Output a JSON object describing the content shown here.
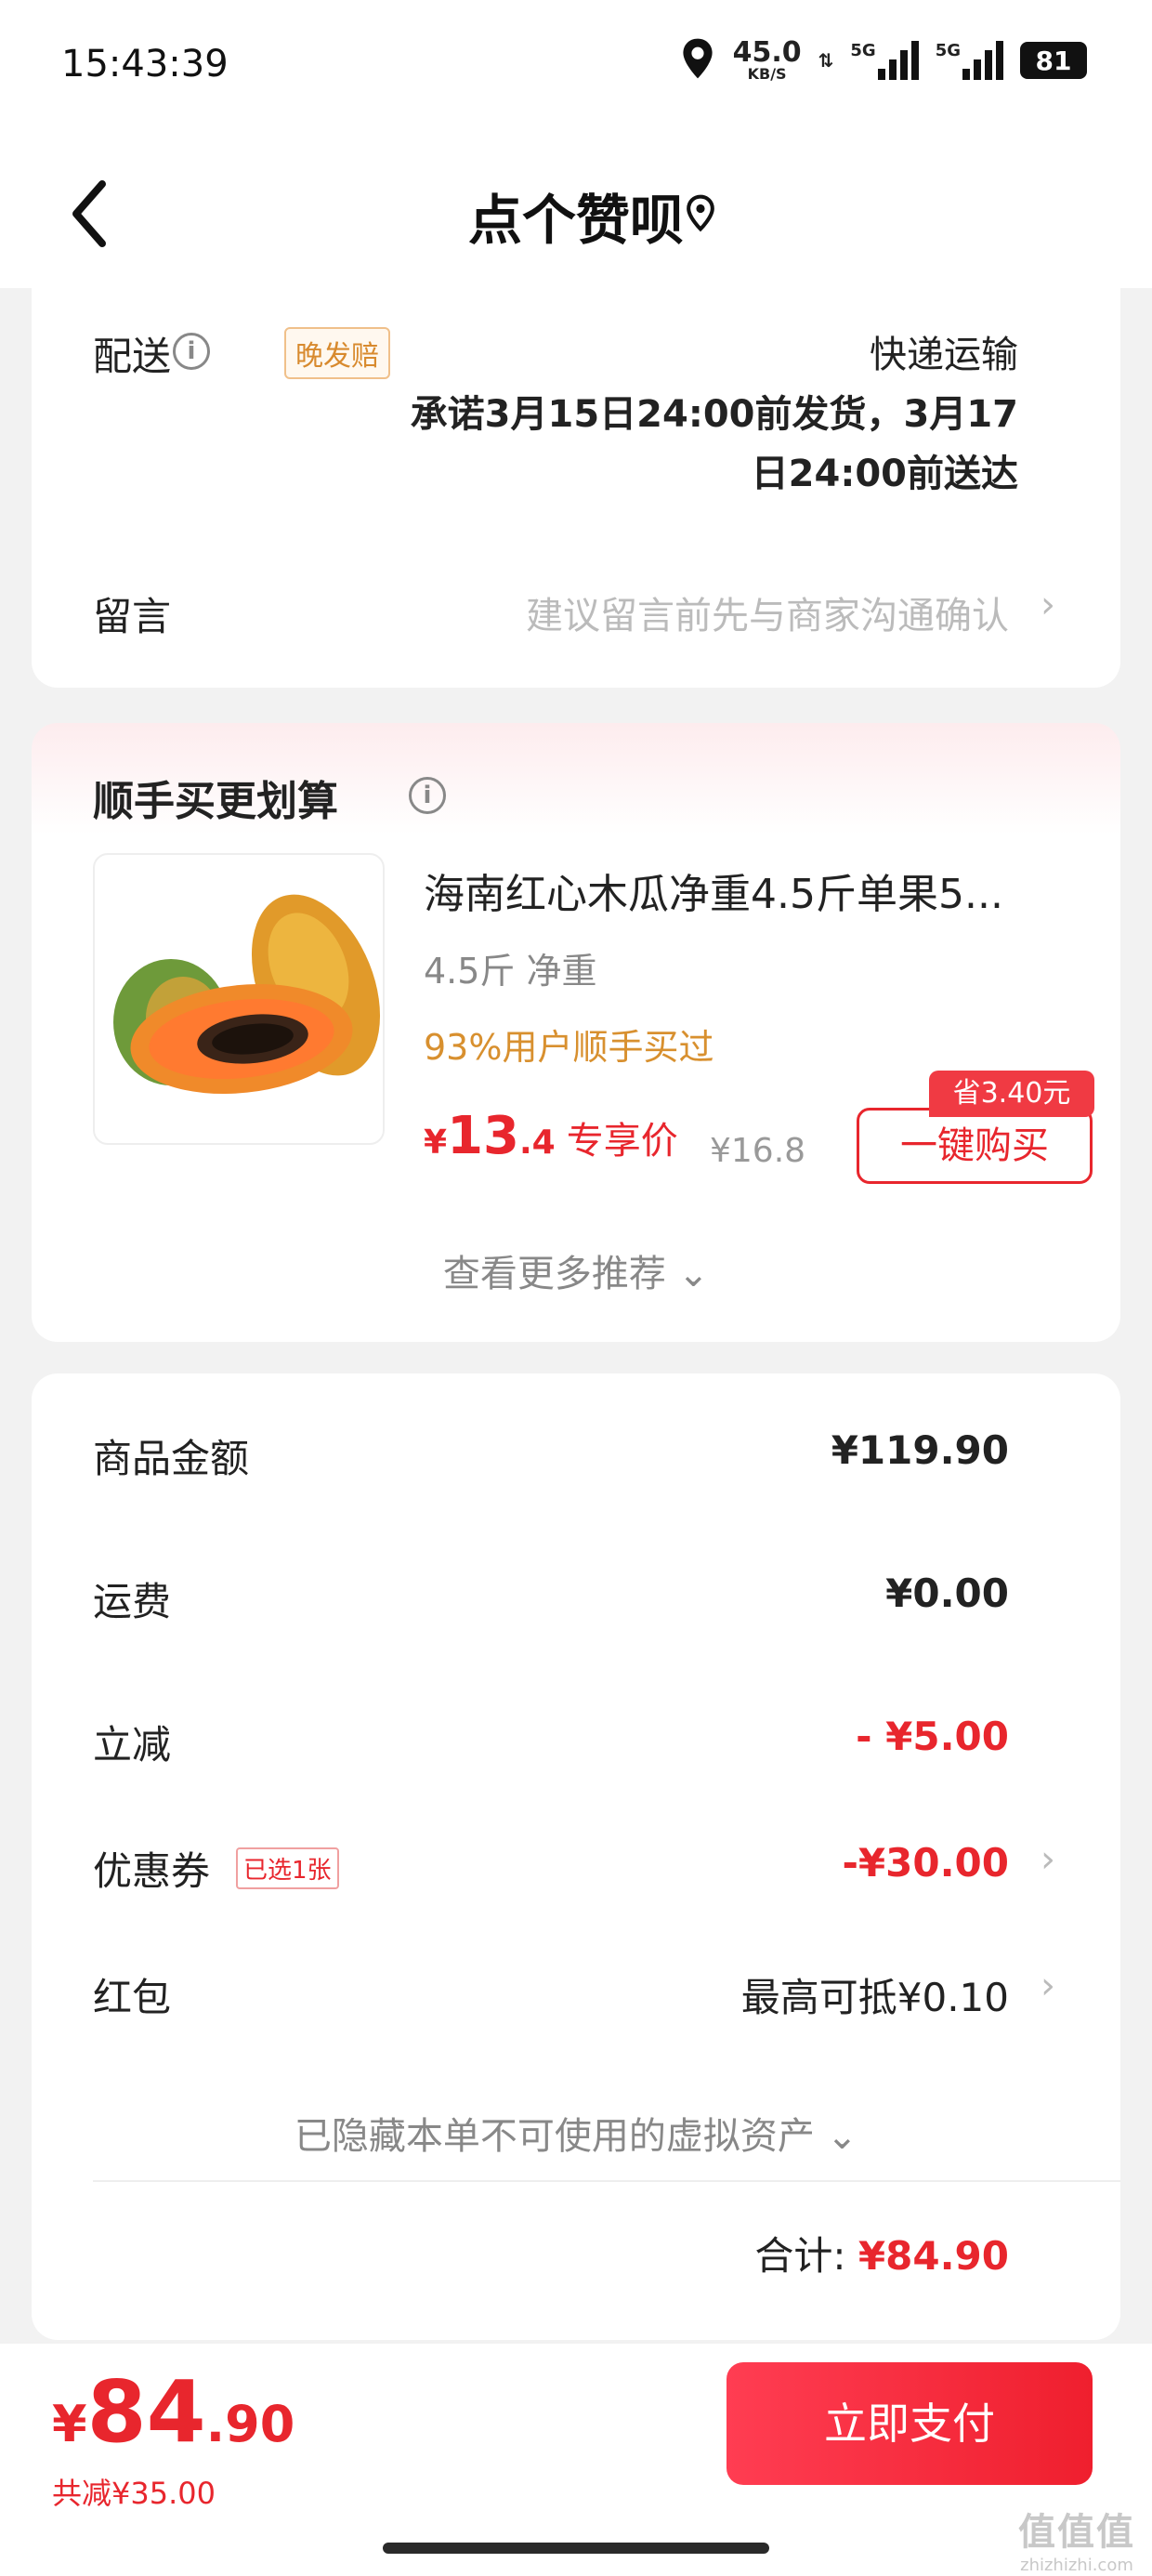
{
  "status_bar": {
    "time": "15:43:39",
    "speed_value": "45.0",
    "speed_unit": "KB/S",
    "net1_label": "5G",
    "net2_label": "5G",
    "battery": "81"
  },
  "header": {
    "title": "点个赞呗"
  },
  "delivery": {
    "label": "配送",
    "badge": "晚发赔",
    "method": "快递运输",
    "promise_line1": "承诺3月15日24:00前发货，3月17",
    "promise_line2": "日24:00前送达",
    "message_label": "留言",
    "message_placeholder": "建议留言前先与商家沟通确认"
  },
  "recommend": {
    "title": "顺手买更划算",
    "product_name": "海南红心木瓜净重4.5斤单果5...",
    "spec": "4.5斤 净重",
    "stat": "93%用户顺手买过",
    "price_currency": "¥",
    "price_int": "13",
    "price_dec": ".4",
    "price_tag": "专享价",
    "original_price": "¥16.8",
    "save_badge": "省3.40元",
    "buy_button": "一键购买",
    "more": "查看更多推荐"
  },
  "summary": {
    "rows": [
      {
        "label": "商品金额",
        "value": "¥119.90"
      },
      {
        "label": "运费",
        "value": "¥0.00"
      },
      {
        "label": "立减",
        "value": "- ¥5.00"
      },
      {
        "label": "优惠券",
        "value": "-¥30.00",
        "badge": "已选1张"
      },
      {
        "label": "红包",
        "value": "最高可抵¥0.10"
      }
    ],
    "hidden_assets": "已隐藏本单不可使用的虚拟资产",
    "total_label": "合计:",
    "total_value": "¥84.90"
  },
  "footer": {
    "price_currency": "¥",
    "price_int": "84",
    "price_dec": ".90",
    "saved": "共减¥35.00",
    "pay_button": "立即支付",
    "watermark_main": "值值值",
    "watermark_sub": "zhizhizhi.com"
  },
  "colors": {
    "accent_red": "#e8262d",
    "orange": "#d8902f",
    "gray_text": "#888888"
  }
}
